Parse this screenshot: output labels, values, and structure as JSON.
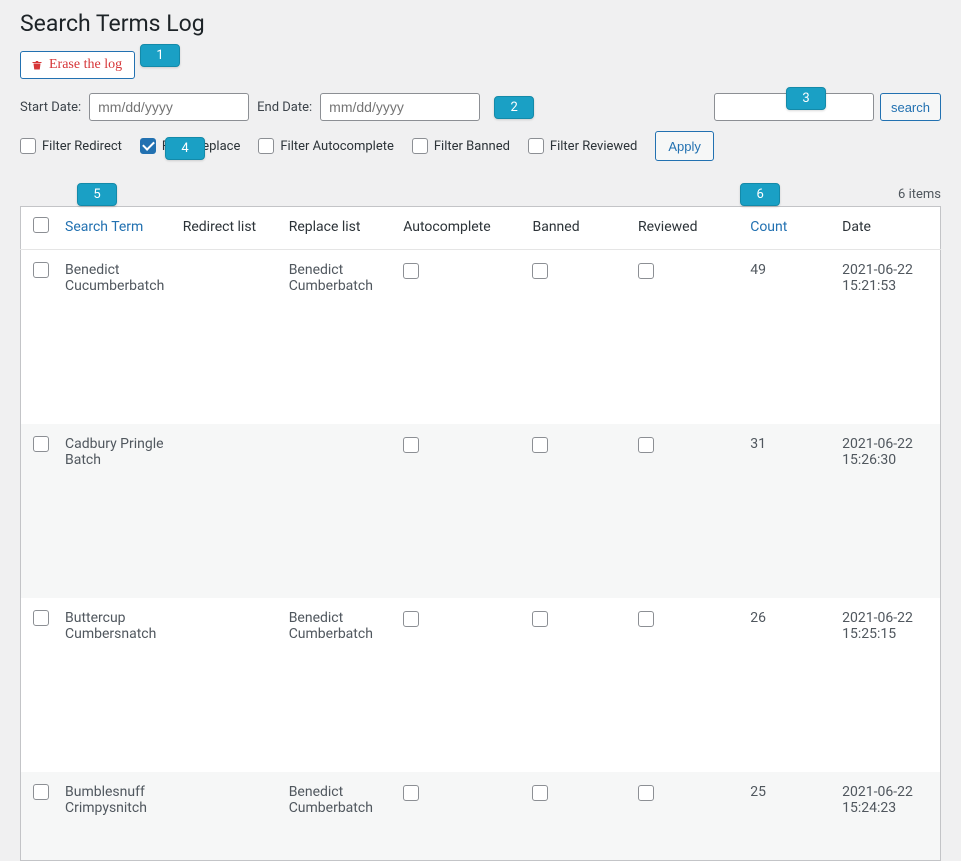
{
  "page": {
    "title": "Search Terms Log",
    "erase_label": "Erase the log",
    "start_date_label": "Start Date:",
    "end_date_label": "End Date:",
    "date_placeholder": "mm/dd/yyyy",
    "search_button": "search",
    "apply_button": "Apply",
    "items_count": "6 items"
  },
  "filters": {
    "redirect": "Filter Redirect",
    "replace": "Filter Replace",
    "autocomplete": "Filter Autocomplete",
    "banned": "Filter Banned",
    "reviewed": "Filter Reviewed",
    "replace_checked": true
  },
  "columns": {
    "search_term": "Search Term",
    "redirect_list": "Redirect list",
    "replace_list": "Replace list",
    "autocomplete": "Autocomplete",
    "banned": "Banned",
    "reviewed": "Reviewed",
    "count": "Count",
    "date": "Date"
  },
  "rows": [
    {
      "term": "Benedict Cucumberbatch",
      "redirect": "",
      "replace": "Benedict Cumberbatch",
      "count": "49",
      "date": "2021-06-22 15:21:53"
    },
    {
      "term": "Cadbury Pringle Batch",
      "redirect": "",
      "replace": "",
      "count": "31",
      "date": "2021-06-22 15:26:30"
    },
    {
      "term": "Buttercup Cumbersnatch",
      "redirect": "",
      "replace": "Benedict Cumberbatch",
      "count": "26",
      "date": "2021-06-22 15:25:15"
    },
    {
      "term": "Bumblesnuff Crimpysnitch",
      "redirect": "",
      "replace": "Benedict Cumberbatch",
      "count": "25",
      "date": "2021-06-22 15:24:23"
    }
  ],
  "markers": {
    "m1": "1",
    "m2": "2",
    "m3": "3",
    "m4": "4",
    "m5": "5",
    "m6": "6"
  }
}
